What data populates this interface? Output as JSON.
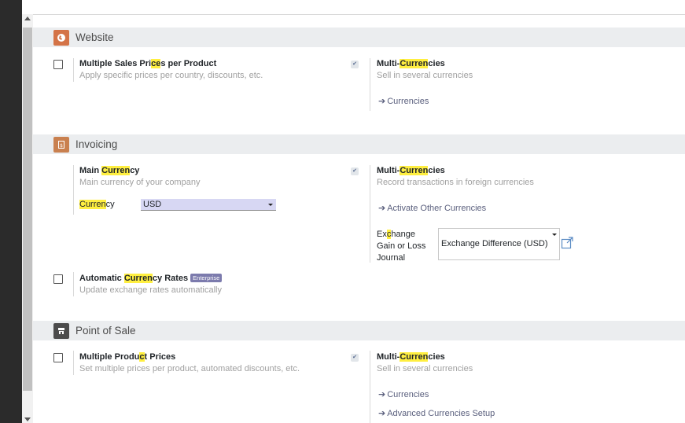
{
  "colors": {
    "website_icon": "#d47347",
    "invoicing_icon": "#c9804f",
    "pos_icon": "#4c4c4c",
    "highlight": "#ffef40",
    "badge": "#7c7bad",
    "select_bg": "#d7d7f3"
  },
  "icons": {
    "website": "globe-icon",
    "invoicing": "invoice-icon",
    "pos": "store-icon",
    "link_arrow": "arrow-right-icon",
    "external": "external-link-icon"
  },
  "website": {
    "title": "Website",
    "multi_sales": {
      "title_pre": "Multiple Sales Pri",
      "title_mark": "ce",
      "title_post": "s per Product",
      "desc": "Apply specific prices per country, discounts, etc.",
      "checked": false
    },
    "multi_currencies": {
      "title_pre": "Multi-",
      "title_mark": "Curren",
      "title_post": "cies",
      "desc": "Sell in several currencies",
      "link": "Currencies"
    }
  },
  "invoicing": {
    "title": "Invoicing",
    "main_currency": {
      "title_pre": "Main ",
      "title_mark": "Curren",
      "title_post": "cy",
      "desc": "Main currency of your company",
      "field_label_mark": "Curren",
      "field_label_post": "cy",
      "field_value": "USD"
    },
    "multi_currencies": {
      "title_pre": "Multi-",
      "title_mark": "Curren",
      "title_post": "cies",
      "desc": "Record transactions in foreign currencies",
      "link": "Activate Other Currencies",
      "journal_label_line1_pre": "Ex",
      "journal_label_line1_mark": "c",
      "journal_label_line1_post": "hange",
      "journal_label_line2": "Gain or Loss",
      "journal_label_line3": "Journal",
      "journal_value": "Exchange Difference (USD)"
    },
    "auto_rates": {
      "title_pre": "Automatic ",
      "title_mark": "Curren",
      "title_post": "cy Rates",
      "badge": "Enterprise",
      "desc": "Update exchange rates automatically",
      "checked": false
    }
  },
  "pos": {
    "title": "Point of Sale",
    "multi_product": {
      "title_pre": "Multiple Produ",
      "title_mark": "c",
      "title_post": "t Prices",
      "desc": "Set multiple prices per product, automated discounts, etc.",
      "checked": false
    },
    "multi_currencies": {
      "title_pre": "Multi-",
      "title_mark": "Curren",
      "title_post": "cies",
      "desc": "Sell in several currencies",
      "link1": "Currencies",
      "link2": "Advanced Currencies Setup"
    }
  }
}
